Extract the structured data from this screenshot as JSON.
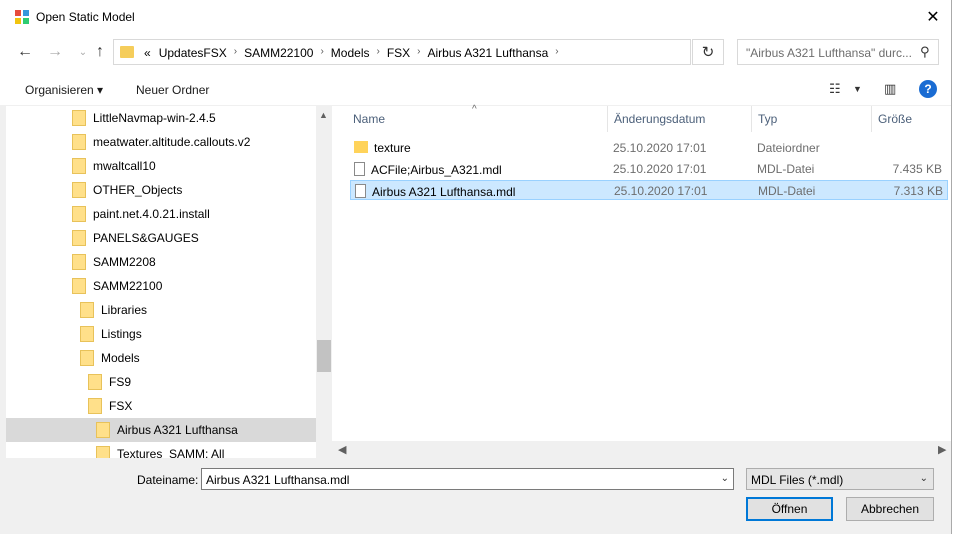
{
  "window": {
    "title": "Open Static Model"
  },
  "nav": {
    "crumbs": [
      "«",
      "UpdatesFSX",
      "SAMM22100",
      "Models",
      "FSX",
      "Airbus A321 Lufthansa"
    ],
    "search_placeholder": "\"Airbus A321 Lufthansa\" durc..."
  },
  "toolbar": {
    "organize": "Organisieren ▾",
    "new_folder": "Neuer Ordner"
  },
  "tree": [
    {
      "label": "LittleNavmap-win-2.4.5",
      "level": 0
    },
    {
      "label": "meatwater.altitude.callouts.v2",
      "level": 0
    },
    {
      "label": "mwaltcall10",
      "level": 0
    },
    {
      "label": "OTHER_Objects",
      "level": 0
    },
    {
      "label": "paint.net.4.0.21.install",
      "level": 0
    },
    {
      "label": "PANELS&GAUGES",
      "level": 0
    },
    {
      "label": "SAMM2208",
      "level": 0
    },
    {
      "label": "SAMM22100",
      "level": 0
    },
    {
      "label": "Libraries",
      "level": 1
    },
    {
      "label": "Listings",
      "level": 1
    },
    {
      "label": "Models",
      "level": 1
    },
    {
      "label": "FS9",
      "level": 2
    },
    {
      "label": "FSX",
      "level": 2
    },
    {
      "label": "Airbus A321 Lufthansa",
      "level": 3,
      "selected": true
    },
    {
      "label": "Textures_SAMM: All",
      "level": 3
    }
  ],
  "columns": {
    "name": "Name",
    "date": "Änderungsdatum",
    "type": "Typ",
    "size": "Größe"
  },
  "files": [
    {
      "name": "texture",
      "date": "25.10.2020 17:01",
      "type": "Dateiordner",
      "size": "",
      "kind": "folder"
    },
    {
      "name": "ACFile;Airbus_A321.mdl",
      "date": "25.10.2020 17:01",
      "type": "MDL-Datei",
      "size": "7.435 KB",
      "kind": "file"
    },
    {
      "name": "Airbus A321 Lufthansa.mdl",
      "date": "25.10.2020 17:01",
      "type": "MDL-Datei",
      "size": "7.313 KB",
      "kind": "file",
      "selected": true
    }
  ],
  "bottom": {
    "filename_label": "Dateiname:",
    "filename_value": "Airbus A321 Lufthansa.mdl",
    "filetype_value": "MDL Files (*.mdl)",
    "open_label": "Öffnen",
    "cancel_label": "Abbrechen"
  }
}
